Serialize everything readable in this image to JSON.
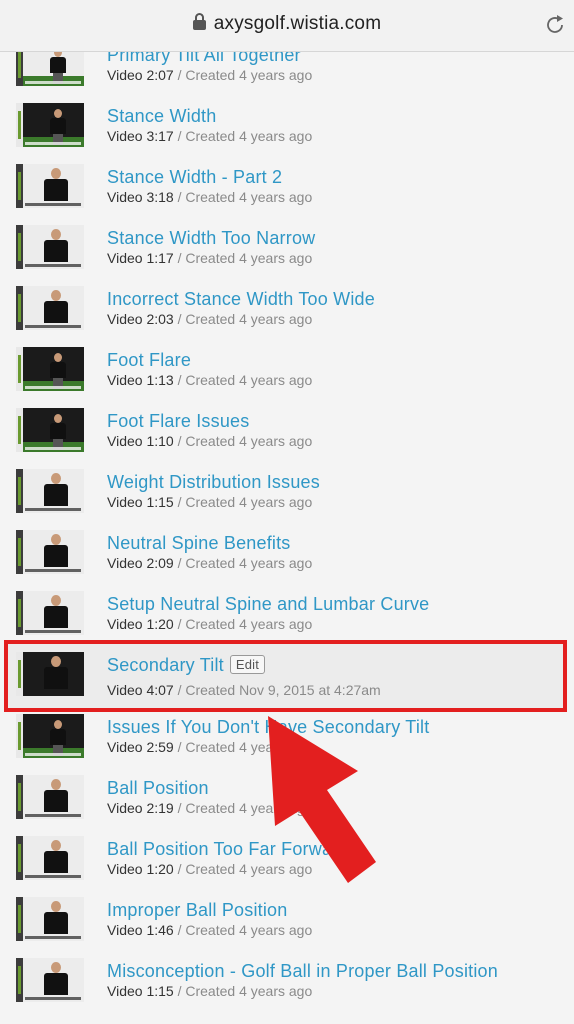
{
  "browser": {
    "url": "axysgolf.wistia.com"
  },
  "videos": [
    {
      "title": "Primary Tilt All Together",
      "duration": "Video 2:07",
      "created": " / Created 4 years ago"
    },
    {
      "title": "Stance Width",
      "duration": "Video 3:17",
      "created": " / Created 4 years ago"
    },
    {
      "title": "Stance Width - Part 2",
      "duration": "Video 3:18",
      "created": " / Created 4 years ago"
    },
    {
      "title": "Stance Width Too Narrow",
      "duration": "Video 1:17",
      "created": " / Created 4 years ago"
    },
    {
      "title": "Incorrect Stance Width Too Wide",
      "duration": "Video 2:03",
      "created": " / Created 4 years ago"
    },
    {
      "title": "Foot Flare",
      "duration": "Video 1:13",
      "created": " / Created 4 years ago"
    },
    {
      "title": "Foot Flare Issues",
      "duration": "Video 1:10",
      "created": " / Created 4 years ago"
    },
    {
      "title": "Weight Distribution Issues",
      "duration": "Video 1:15",
      "created": " / Created 4 years ago"
    },
    {
      "title": "Neutral Spine Benefits",
      "duration": "Video 2:09",
      "created": " / Created 4 years ago"
    },
    {
      "title": "Setup Neutral Spine and Lumbar Curve",
      "duration": "Video 1:20",
      "created": " / Created 4 years ago"
    },
    {
      "title": "Secondary Tilt",
      "duration": "Video 4:07",
      "created": " / Created Nov 9, 2015 at 4:27am",
      "edit_label": "Edit"
    },
    {
      "title": "Issues If You Don't Have Secondary Tilt",
      "duration": "Video 2:59",
      "created": " / Created 4 years ago"
    },
    {
      "title": "Ball Position",
      "duration": "Video 2:19",
      "created": " / Created 4 years ago"
    },
    {
      "title": "Ball Position Too Far Forward",
      "duration": "Video 1:20",
      "created": " / Created 4 years ago"
    },
    {
      "title": "Improper Ball Position",
      "duration": "Video 1:46",
      "created": " / Created 4 years ago"
    },
    {
      "title": "Misconception - Golf Ball in Proper Ball Position",
      "duration": "Video 1:15",
      "created": " / Created 4 years ago"
    }
  ],
  "colors": {
    "link": "#2f97c6",
    "highlight": "#e31f1f"
  }
}
